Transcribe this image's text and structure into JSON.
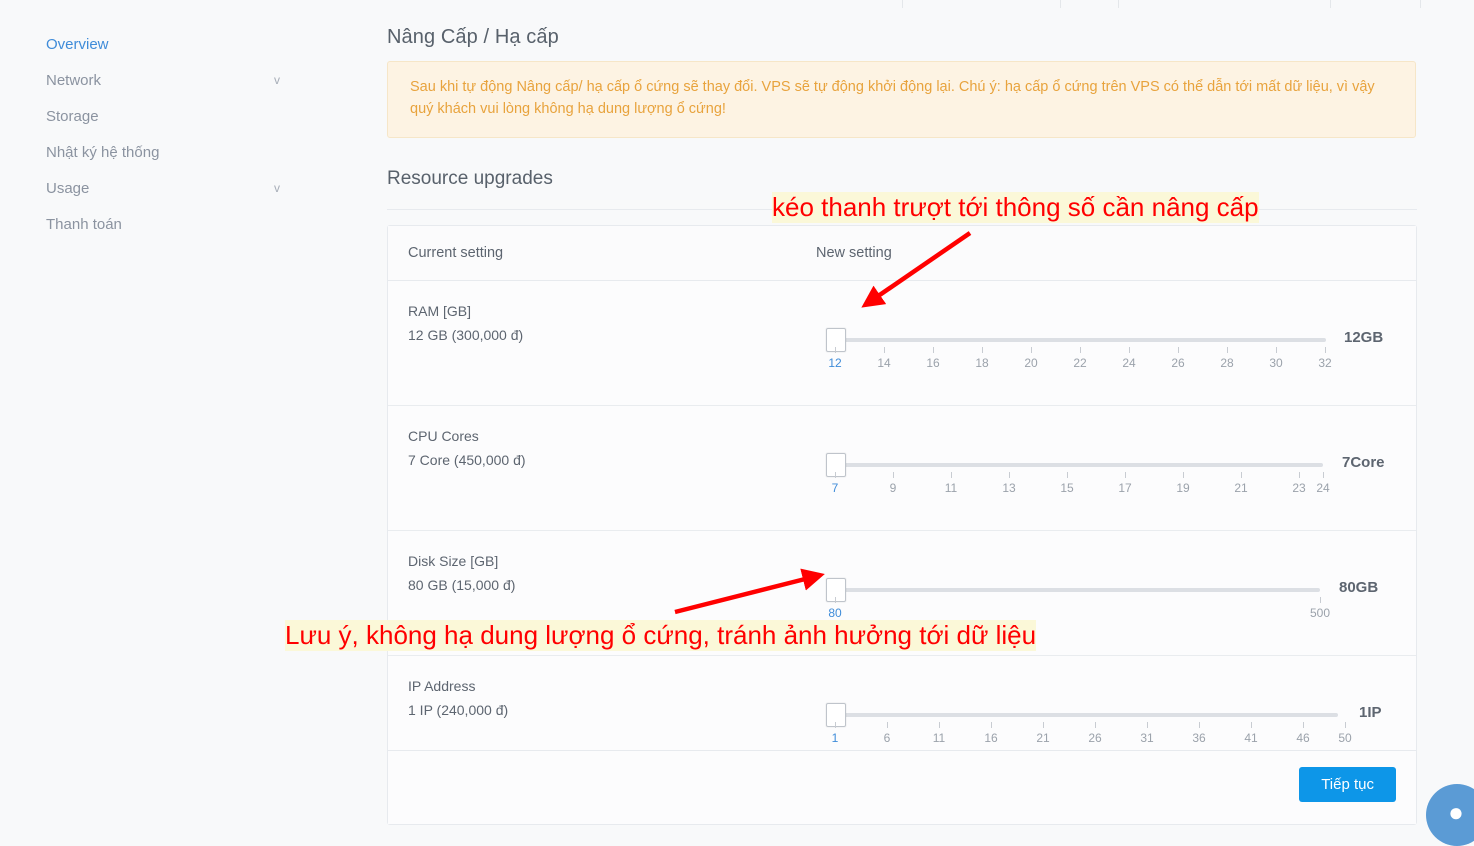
{
  "sidebar": {
    "items": [
      {
        "label": "Overview",
        "active": true,
        "chevron": ""
      },
      {
        "label": "Network",
        "active": false,
        "chevron": "v"
      },
      {
        "label": "Storage",
        "active": false,
        "chevron": ""
      },
      {
        "label": "Nhật ký hệ thống",
        "active": false,
        "chevron": ""
      },
      {
        "label": "Usage",
        "active": false,
        "chevron": "v"
      },
      {
        "label": "Thanh toán",
        "active": false,
        "chevron": ""
      }
    ]
  },
  "main": {
    "page_title": "Nâng Cấp / Hạ cấp",
    "warning": "Sau khi tự động Nâng cấp/ hạ cấp ổ cứng sẽ thay đổi. VPS sẽ tự động khởi động lại. Chú ý: hạ cấp ổ cứng trên VPS có thể dẫn tới mất dữ liệu, vì vậy quý khách vui lòng không hạ dung lượng ổ cứng!",
    "section_title": "Resource upgrades",
    "table": {
      "headers": {
        "current": "Current setting",
        "new": "New setting"
      },
      "rows": [
        {
          "name": "RAM [GB]",
          "current": "12 GB (300,000 đ)",
          "value_label": "12GB",
          "ticks": [
            "12",
            "14",
            "16",
            "18",
            "20",
            "22",
            "24",
            "26",
            "28",
            "30",
            "32"
          ],
          "thumb_value": "12"
        },
        {
          "name": "CPU Cores",
          "current": "7 Core (450,000 đ)",
          "value_label": "7Core",
          "ticks": [
            "7",
            "9",
            "11",
            "13",
            "15",
            "17",
            "19",
            "21",
            "23",
            "24"
          ],
          "thumb_value": "7"
        },
        {
          "name": "Disk Size [GB]",
          "current": "80 GB (15,000 đ)",
          "value_label": "80GB",
          "ticks": [
            "80",
            "500"
          ],
          "thumb_value": "80"
        },
        {
          "name": "IP Address",
          "current": "1 IP (240,000 đ)",
          "value_label": "1IP",
          "ticks": [
            "1",
            "6",
            "11",
            "16",
            "21",
            "26",
            "31",
            "36",
            "41",
            "46",
            "50"
          ],
          "thumb_value": "1"
        }
      ]
    },
    "continue_button": "Tiếp tục"
  },
  "annotations": [
    {
      "text": "kéo thanh trượt tới thông số cần nâng cấp"
    },
    {
      "text": "Lưu ý, không hạ dung lượng ổ cứng, tránh ảnh hưởng tới dữ liệu"
    }
  ],
  "colors": {
    "accent_blue": "#3f8cd9",
    "button_blue": "#0d96e8",
    "warning_text": "#e8a33d",
    "warning_bg": "#fdf3e3",
    "annotation_red": "#ff0000",
    "annotation_bg": "#fbf8d8"
  },
  "chat_widget": {
    "icon": "support-chat-icon"
  }
}
